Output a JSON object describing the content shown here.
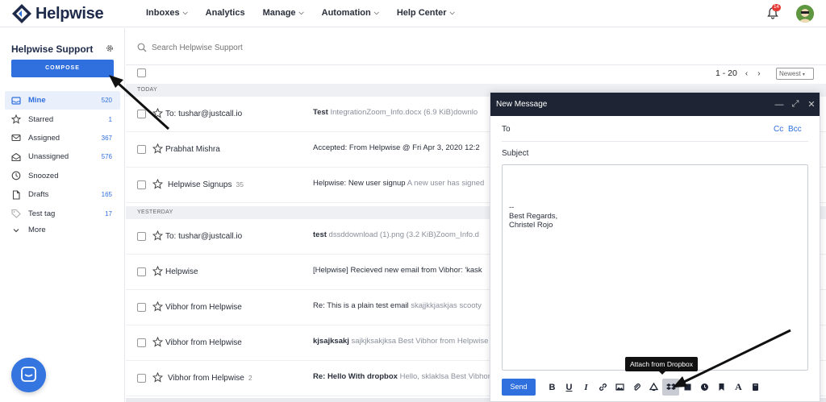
{
  "topbar": {
    "brand": "Helpwise",
    "nav": [
      "Inboxes",
      "Analytics",
      "Manage",
      "Automation",
      "Help Center"
    ],
    "nav_has_dropdown": [
      true,
      false,
      true,
      true,
      true
    ],
    "notification_count": "14"
  },
  "sidebar": {
    "title": "Helpwise Support",
    "compose_label": "COMPOSE",
    "items": [
      {
        "label": "Mine",
        "count": "520",
        "icon": "inbox-icon",
        "active": true
      },
      {
        "label": "Starred",
        "count": "1",
        "icon": "star-icon"
      },
      {
        "label": "Assigned",
        "count": "367",
        "icon": "envelope-icon"
      },
      {
        "label": "Unassigned",
        "count": "576",
        "icon": "envelope-open-icon"
      },
      {
        "label": "Snoozed",
        "count": "",
        "icon": "clock-icon"
      },
      {
        "label": "Drafts",
        "count": "165",
        "icon": "file-icon"
      },
      {
        "label": "Test tag",
        "count": "17",
        "icon": "tag-icon"
      },
      {
        "label": "More",
        "count": "",
        "icon": "chevron-down-icon"
      }
    ]
  },
  "list": {
    "search_placeholder": "Search Helpwise Support",
    "range": "1 - 20",
    "sort": "Newest",
    "groups": {
      "today": "TODAY",
      "yesterday": "YESTERDAY"
    },
    "rows": [
      {
        "sender": "To: tushar@justcall.io",
        "count": "",
        "subject_bold": "Test",
        "subject": "",
        "snippet": "IntegrationZoom_Info.docx (6.9 KiB)downlo"
      },
      {
        "sender": "Prabhat Mishra",
        "count": "",
        "subject_bold": "",
        "subject": "Accepted: From Helpwise @ Fri Apr 3, 2020 12:2",
        "snippet": ""
      },
      {
        "sender": "Helpwise Signups",
        "count": "35",
        "subject_bold": "",
        "subject": "Helpwise: New user signup",
        "snippet": "A new user has signed"
      },
      {
        "sender": "To: tushar@justcall.io",
        "count": "",
        "subject_bold": "test",
        "subject": "",
        "snippet": "dssddownload (1).png (3.2 KiB)Zoom_Info.d"
      },
      {
        "sender": "Helpwise",
        "count": "",
        "subject_bold": "",
        "subject": "[Helpwise] Recieved new email from Vibhor: 'kask",
        "snippet": ""
      },
      {
        "sender": "Vibhor from Helpwise",
        "count": "",
        "subject_bold": "",
        "subject": "Re: This is a plain test email",
        "snippet": "skajjkkjaskjas scooty"
      },
      {
        "sender": "Vibhor from Helpwise",
        "count": "",
        "subject_bold": "kjsajksakj",
        "subject": "",
        "snippet": "sajkjksakjksa Best Vibhor from Helpwise"
      },
      {
        "sender": "Vibhor from Helpwise",
        "count": "2",
        "subject_bold": "Re: Hello With dropbox",
        "subject": "",
        "snippet": "Hello, sklaklsa Best Vibhor from Helpwise"
      }
    ]
  },
  "compose": {
    "title": "New Message",
    "to_label": "To",
    "cc_label": "Cc",
    "bcc_label": "Bcc",
    "subject_label": "Subject",
    "body": "--\nBest Regards,\nChristel Rojo",
    "send_label": "Send",
    "tooltip": "Attach from Dropbox"
  },
  "colors": {
    "accent": "#2f6fde",
    "header_dark": "#1e2433",
    "badge": "#e53935"
  }
}
